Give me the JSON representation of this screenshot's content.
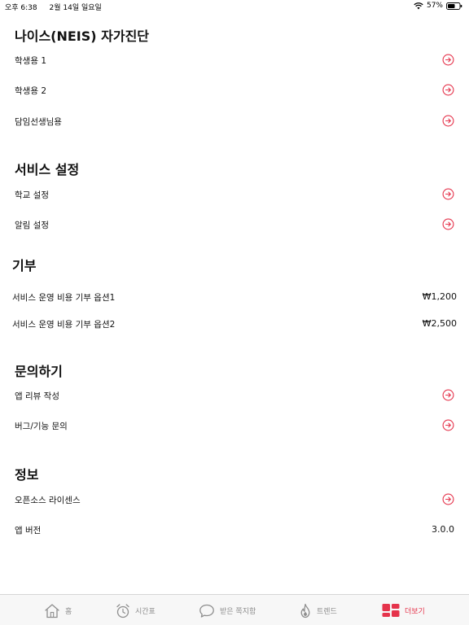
{
  "status_bar": {
    "time": "오후 6:38",
    "date": "2월 14일 일요일",
    "battery_percent": "57%"
  },
  "sections": {
    "neis": {
      "title": "나이스(NEIS) 자가진단",
      "items": [
        {
          "label": "학생용 1"
        },
        {
          "label": "학생용 2"
        },
        {
          "label": "담임선생님용"
        }
      ]
    },
    "service": {
      "title": "서비스 설정",
      "items": [
        {
          "label": "학교 설정"
        },
        {
          "label": "알림 설정"
        }
      ]
    },
    "donate": {
      "title": "기부",
      "items": [
        {
          "label": "서비스 운영 비용 기부 옵션1",
          "price": "₩1,200"
        },
        {
          "label": "서비스 운영 비용 기부 옵션2",
          "price": "₩2,500"
        }
      ]
    },
    "inquiry": {
      "title": "문의하기",
      "items": [
        {
          "label": "앱 리뷰 작성"
        },
        {
          "label": "버그/기능 문의"
        }
      ]
    },
    "info": {
      "title": "정보",
      "items": [
        {
          "label": "오픈소스 라이센스"
        },
        {
          "label": "앱 버전",
          "value": "3.0.0"
        }
      ]
    }
  },
  "tab_bar": {
    "tabs": [
      {
        "label": "홈",
        "icon": "home-icon"
      },
      {
        "label": "시간표",
        "icon": "alarm-clock-icon"
      },
      {
        "label": "받은 쪽지함",
        "icon": "chat-bubble-icon"
      },
      {
        "label": "트렌드",
        "icon": "flame-icon"
      },
      {
        "label": "더보기",
        "icon": "grid-icon",
        "active": true
      }
    ]
  },
  "colors": {
    "accent": "#e5334b",
    "inactive_tab": "#8e8e8e",
    "text": "#111111"
  }
}
